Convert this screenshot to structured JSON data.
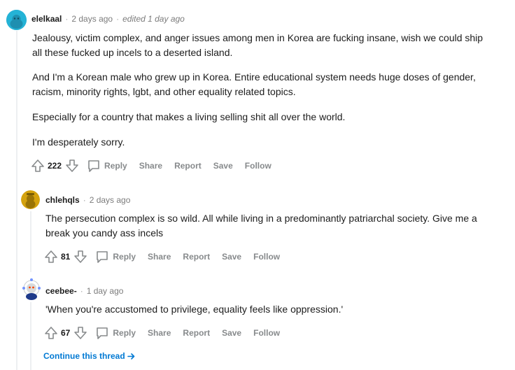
{
  "colors": {
    "link": "#0079d3",
    "muted": "#878a8c",
    "text": "#1c1c1c",
    "thread_line": "#edeff1"
  },
  "comments": [
    {
      "avatar": "avatar-snoo-teal-icon",
      "user": "elelkaal",
      "time": "2 days ago",
      "edited": "edited 1 day ago",
      "paragraphs": [
        "Jealousy, victim complex, and anger issues among men in Korea are fucking insane, wish we could ship all these fucked up incels to a deserted island.",
        "And I'm a Korean male who grew up in Korea. Entire educational system needs huge doses of gender, racism, minority rights, lgbt, and other equality related topics.",
        "Especially for a country that makes a living selling shit all over the world.",
        "I'm desperately sorry."
      ],
      "score": "222",
      "actions": {
        "reply": "Reply",
        "share": "Share",
        "report": "Report",
        "save": "Save",
        "follow": "Follow"
      }
    },
    {
      "avatar": "avatar-snoo-yellow-icon",
      "user": "chlehqls",
      "time": "2 days ago",
      "paragraphs": [
        "The persecution complex is so wild. All while living in a predominantly patriarchal society. Give me a break you candy ass incels"
      ],
      "score": "81",
      "actions": {
        "reply": "Reply",
        "share": "Share",
        "report": "Report",
        "save": "Save",
        "follow": "Follow"
      }
    },
    {
      "avatar": "avatar-snoo-blue-icon",
      "user": "ceebee-",
      "time": "1 day ago",
      "paragraphs": [
        "'When you're accustomed to privilege, equality feels like oppression.'"
      ],
      "score": "67",
      "actions": {
        "reply": "Reply",
        "share": "Share",
        "report": "Report",
        "save": "Save",
        "follow": "Follow"
      }
    }
  ],
  "continue_thread": "Continue this thread"
}
